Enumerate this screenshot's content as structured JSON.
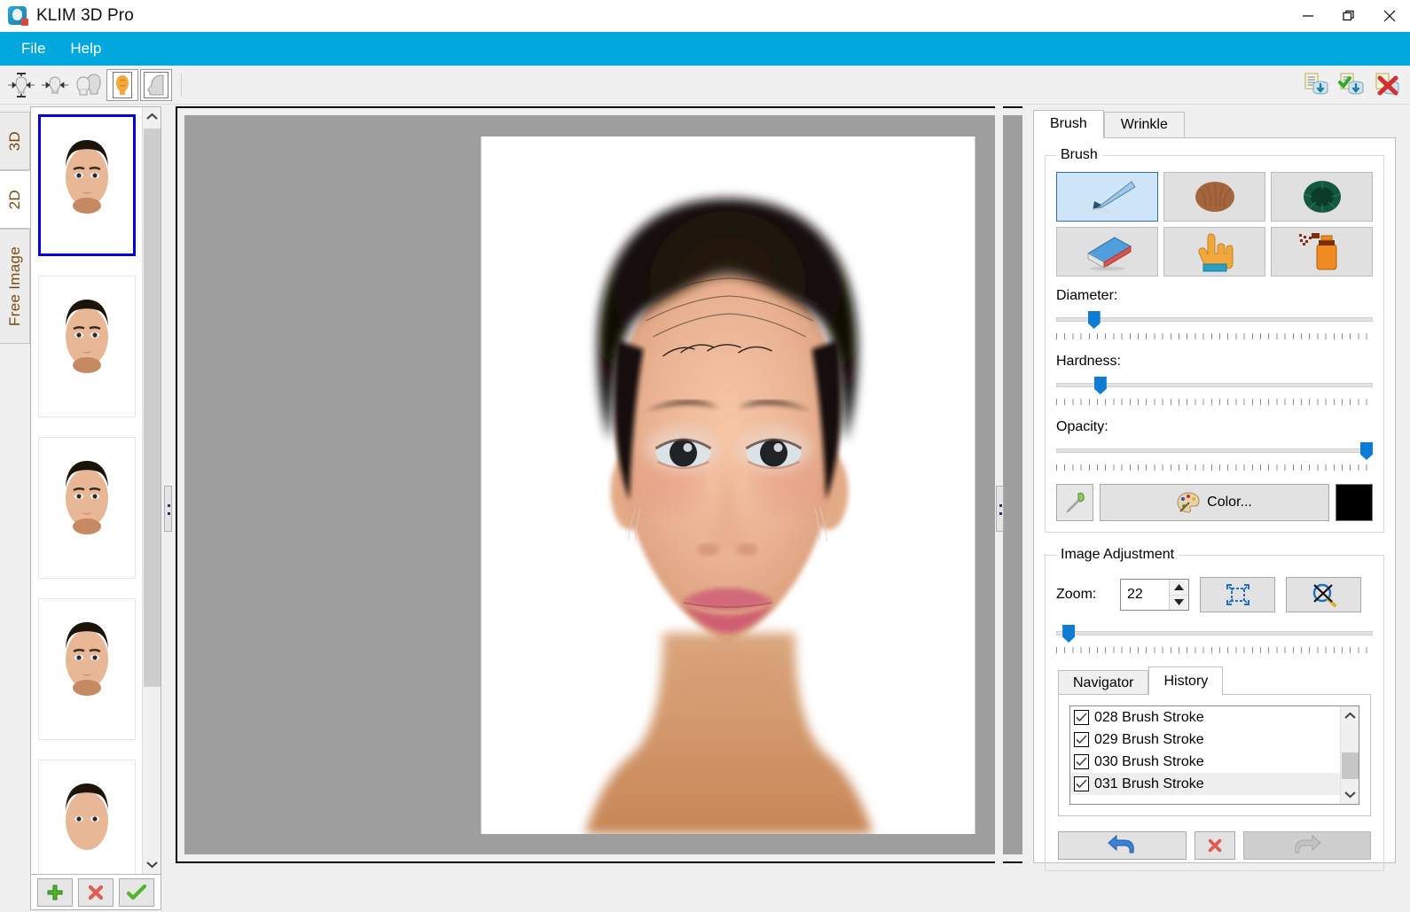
{
  "window": {
    "title": "KLIM 3D Pro",
    "app_icon": "app-logo-icon",
    "minimize": "minimize-icon",
    "restore": "restore-icon",
    "close": "close-icon"
  },
  "menubar": {
    "items": [
      {
        "label": "File"
      },
      {
        "label": "Help"
      }
    ]
  },
  "toolbar": {
    "left_tools": [
      {
        "name": "symmetry-both-axes-icon",
        "title": "Symmetry both axes"
      },
      {
        "name": "symmetry-horizontal-icon",
        "title": "Symmetry horizontal"
      },
      {
        "name": "front-and-profile-icon",
        "title": "Front and profile"
      },
      {
        "name": "front-face-texture-icon",
        "title": "Front face texture"
      },
      {
        "name": "profile-face-icon",
        "title": "Profile face"
      }
    ],
    "right_tools": [
      {
        "name": "database-load-icon",
        "title": "Load from database"
      },
      {
        "name": "database-save-icon",
        "title": "Save to database"
      },
      {
        "name": "database-delete-icon",
        "title": "Delete from database"
      }
    ]
  },
  "left_panel": {
    "vertical_tabs": [
      {
        "label": "3D",
        "active": false
      },
      {
        "label": "2D",
        "active": true
      },
      {
        "label": "Free Image",
        "active": false
      }
    ],
    "thumbnails": [
      {
        "index": 1,
        "selected": true
      },
      {
        "index": 2,
        "selected": false
      },
      {
        "index": 3,
        "selected": false
      },
      {
        "index": 4,
        "selected": false
      },
      {
        "index": 5,
        "selected": false
      }
    ],
    "buttons": [
      {
        "name": "add-image-button",
        "icon": "plus-icon"
      },
      {
        "name": "delete-image-button",
        "icon": "red-cross-icon"
      },
      {
        "name": "confirm-image-button",
        "icon": "green-check-icon"
      }
    ],
    "scrollbar": {
      "up": "chevron-up-icon",
      "down": "chevron-down-icon"
    }
  },
  "canvas": {
    "background_color": "#9e9e9e",
    "paper_color": "#ffffff",
    "content": "frontal-face-render"
  },
  "right_panel": {
    "tabs": [
      {
        "label": "Brush",
        "active": true
      },
      {
        "label": "Wrinkle",
        "active": false
      }
    ],
    "brush_group": {
      "legend": "Brush",
      "tools": [
        {
          "name": "paintbrush-tool",
          "icon": "paintbrush-icon",
          "selected": true
        },
        {
          "name": "hair-brush-tool",
          "icon": "hair-tuft-icon",
          "selected": false
        },
        {
          "name": "sponge-brush-tool",
          "icon": "green-sponge-icon",
          "selected": false
        },
        {
          "name": "eraser-tool",
          "icon": "eraser-icon",
          "selected": false
        },
        {
          "name": "smudge-tool",
          "icon": "pointing-hand-icon",
          "selected": false
        },
        {
          "name": "spray-tool",
          "icon": "spray-can-icon",
          "selected": false
        }
      ],
      "sliders": [
        {
          "label": "Diameter:",
          "value_pct": 11
        },
        {
          "label": "Hardness:",
          "value_pct": 13
        },
        {
          "label": "Opacity:",
          "value_pct": 100
        }
      ],
      "eyedropper": "eyedropper-icon",
      "color_button": "Color...",
      "color_button_icon": "palette-icon",
      "current_color": "#000000"
    },
    "image_adjustment": {
      "legend": "Image Adjustment",
      "zoom_label": "Zoom:",
      "zoom_value": "22",
      "zoom_slider_pct": 3,
      "fit_button_icon": "fit-to-screen-icon",
      "reset_button_icon": "no-zoom-icon",
      "subtabs": [
        {
          "label": "Navigator",
          "active": false
        },
        {
          "label": "History",
          "active": true
        }
      ],
      "history": [
        {
          "label": "028 Brush Stroke",
          "checked": true,
          "selected": false
        },
        {
          "label": "029 Brush Stroke",
          "checked": true,
          "selected": false
        },
        {
          "label": "030 Brush Stroke",
          "checked": true,
          "selected": false
        },
        {
          "label": "031 Brush Stroke",
          "checked": true,
          "selected": true
        }
      ],
      "history_buttons": [
        {
          "name": "undo-button",
          "icon": "undo-arrow-icon",
          "disabled": false
        },
        {
          "name": "clear-history-button",
          "icon": "red-cross-icon",
          "disabled": false
        },
        {
          "name": "redo-button",
          "icon": "redo-arrow-icon",
          "disabled": true
        }
      ]
    }
  },
  "colors": {
    "accent": "#00a8dd",
    "selection": "#0000e0",
    "slider_knob": "#0c7cd5",
    "canvas_bg": "#9e9e9e"
  }
}
